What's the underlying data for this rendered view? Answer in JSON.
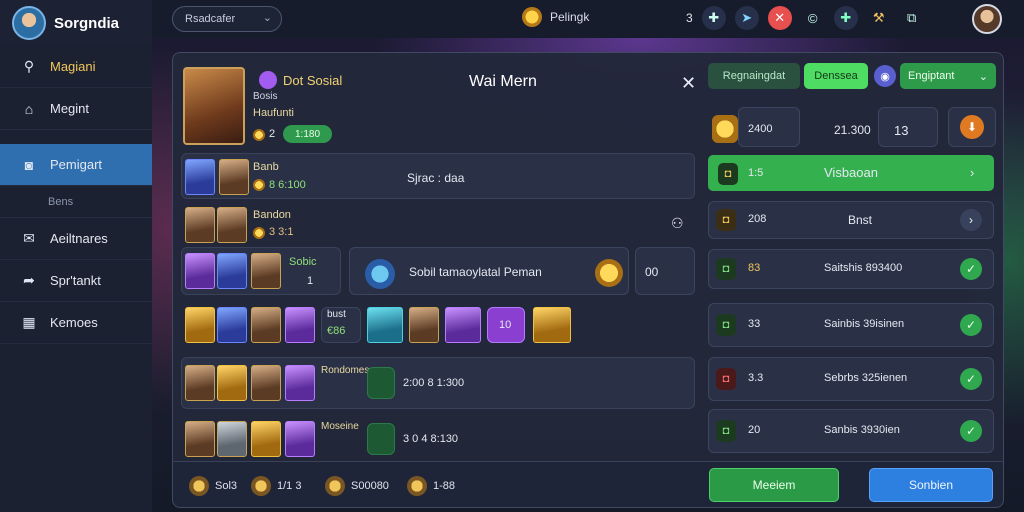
{
  "app": {
    "brand": "Sorgndia",
    "search_value": "Rsadcafer",
    "player_name": "Pelingk",
    "top_count": "3"
  },
  "sidebar": {
    "items": [
      {
        "label": "Magiani",
        "icon": "search-icon"
      },
      {
        "label": "Megint",
        "icon": "home-icon"
      },
      {
        "label": "Pemigart",
        "icon": "camera-icon",
        "active": true
      },
      {
        "label": "Bens",
        "sub": true
      },
      {
        "label": "Aeiltnares",
        "icon": "mail-icon"
      },
      {
        "label": "Spr'tankt",
        "icon": "send-icon"
      },
      {
        "label": "Kemoes",
        "icon": "grid-icon"
      }
    ]
  },
  "panel": {
    "title": "Wai Mern",
    "tag": "Dot Sosial",
    "rows": {
      "r1_name": "Bosis",
      "r1_sub": "Haufunti",
      "r1_num": "2",
      "r1_pill": "1:180",
      "r2_name": "Banb",
      "r2_value": "8 6:100",
      "r2_center": "Sjrac : daa",
      "r3_name": "Bandon",
      "r3_value": "3 3:1",
      "r4_label": "Sobic",
      "r4_num": "1",
      "r4_center": "Sobil tamaoylatal Peman",
      "r4_box": "00",
      "r5_title": "bust",
      "r5_val": "€86",
      "r5_box": "10",
      "r6_title": "Rondomes",
      "r6_val": "2:00 8 1:300",
      "r7_title": "Moseine",
      "r7_val": "3 0 4 8:130"
    },
    "right": {
      "btn_reg": "Regnaingdat",
      "btn_dem": "Denssea",
      "btn_eng": "Engiptant",
      "stat_a": "2400",
      "stat_b": "21.300",
      "stat_c": "13",
      "stars": "★★",
      "green_label": "Visbaoan",
      "green_num": "1:5",
      "r_rows": [
        {
          "num": "208",
          "label": "Bnst"
        },
        {
          "num": "83",
          "label": "Saitshis 893400"
        },
        {
          "num": "33",
          "label": "Sainbis 39isinen"
        },
        {
          "num": "3.3",
          "label": "Sebrbs 325ienen"
        },
        {
          "num": "20",
          "label": "Sanbis 3930ien"
        }
      ]
    },
    "footer": [
      {
        "label": "Sol3"
      },
      {
        "label": "1/1 3"
      },
      {
        "label": "S00080"
      },
      {
        "label": "1-88"
      }
    ],
    "btn_left": "Meeiem",
    "btn_right": "Sonbien"
  },
  "colors": {
    "accent_blue": "#2f6fb0",
    "green": "#2fa84f",
    "panel": "#22283a"
  }
}
